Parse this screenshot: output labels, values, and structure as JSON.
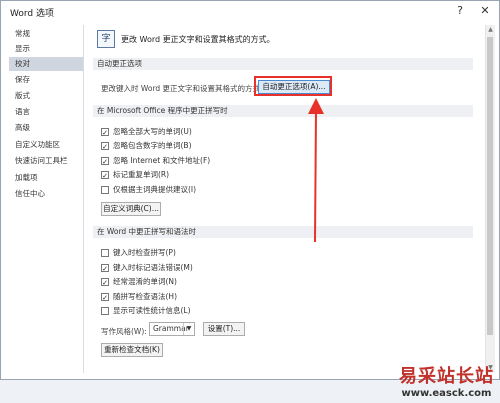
{
  "window": {
    "title": "Word 选项",
    "help_btn": "?",
    "close_btn": "✕"
  },
  "sidebar": {
    "items": [
      {
        "label": "常规"
      },
      {
        "label": "显示"
      },
      {
        "label": "校对"
      },
      {
        "label": "保存"
      },
      {
        "label": "版式"
      },
      {
        "label": "语言"
      },
      {
        "label": "高级"
      },
      {
        "label": "自定义功能区"
      },
      {
        "label": "快速访问工具栏"
      },
      {
        "label": "加载项"
      },
      {
        "label": "信任中心"
      }
    ]
  },
  "header": {
    "icon_char": "字",
    "text": "更改 Word 更正文字和设置其格式的方式。"
  },
  "autocorrect": {
    "section_title": "自动更正选项",
    "description": "更改键入时 Word 更正文字和设置其格式的方式：",
    "button_label": "自动更正选项(A)..."
  },
  "office_section": {
    "title": "在 Microsoft Office 程序中更正拼写时",
    "checkboxes": [
      {
        "label": "忽略全部大写的单词(U)",
        "checked": true
      },
      {
        "label": "忽略包含数字的单词(B)",
        "checked": true
      },
      {
        "label": "忽略 Internet 和文件地址(F)",
        "checked": true
      },
      {
        "label": "标记重复单词(R)",
        "checked": true
      },
      {
        "label": "仅根据主词典提供建议(I)",
        "checked": false
      }
    ],
    "custom_dict_button": "自定义词典(C)..."
  },
  "word_section": {
    "title": "在 Word 中更正拼写和语法时",
    "checkboxes": [
      {
        "label": "键入时检查拼写(P)",
        "checked": false
      },
      {
        "label": "键入时标记语法错误(M)",
        "checked": true
      },
      {
        "label": "经常混淆的单词(N)",
        "checked": true
      },
      {
        "label": "随拼写检查语法(H)",
        "checked": true
      },
      {
        "label": "显示可读性统计信息(L)",
        "checked": false
      }
    ],
    "style_label": "写作风格(W):",
    "style_value": "Grammar",
    "settings_button": "设置(T)...",
    "recheck_button": "重新检查文档(K)"
  },
  "watermark": {
    "main": "易采站长站",
    "url": "www.easck.com"
  },
  "colors": {
    "annotation": "#e8312a",
    "selected_sidebar": "#cfd6df"
  }
}
